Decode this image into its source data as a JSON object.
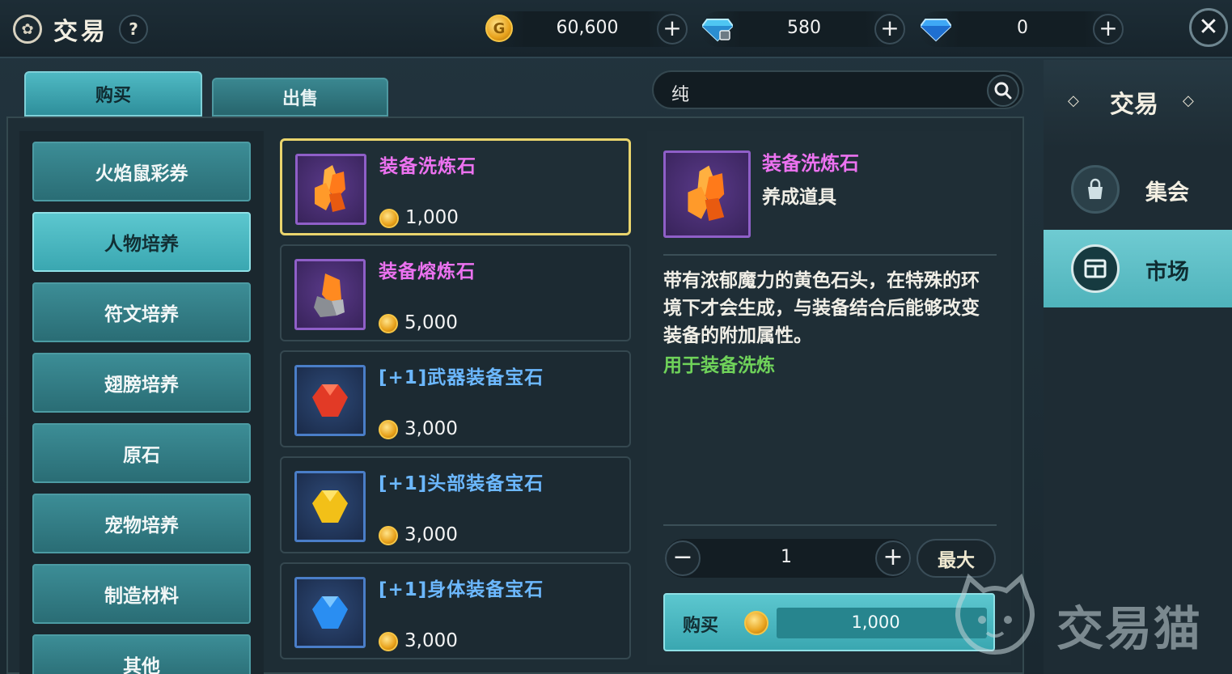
{
  "header": {
    "title": "交易",
    "help": "?",
    "gold": {
      "value": "60,600",
      "coin_glyph": "G"
    },
    "bound_diamond": {
      "value": "580"
    },
    "diamond": {
      "value": "0"
    },
    "plus": "+",
    "close": "✕"
  },
  "tabs": [
    {
      "label": "购买",
      "active": true
    },
    {
      "label": "出售",
      "active": false
    }
  ],
  "search": {
    "value": "纯"
  },
  "categories": [
    {
      "label": "火焰鼠彩券",
      "active": false
    },
    {
      "label": "人物培养",
      "active": true
    },
    {
      "label": "符文培养",
      "active": false
    },
    {
      "label": "翅膀培养",
      "active": false
    },
    {
      "label": "原石",
      "active": false
    },
    {
      "label": "宠物培养",
      "active": false
    },
    {
      "label": "制造材料",
      "active": false
    },
    {
      "label": "其他",
      "active": false
    }
  ],
  "items": [
    {
      "name": "装备洗炼石",
      "price": "1,000",
      "rarity": "purple",
      "icon": "orange-crystal-icon",
      "selected": true
    },
    {
      "name": "装备熔炼石",
      "price": "5,000",
      "rarity": "purple",
      "icon": "molten-stone-icon",
      "selected": false
    },
    {
      "name": "[+1]武器装备宝石",
      "price": "3,000",
      "rarity": "blue",
      "icon": "red-gem-icon",
      "selected": false
    },
    {
      "name": "[+1]头部装备宝石",
      "price": "3,000",
      "rarity": "blue",
      "icon": "yellow-gem-icon",
      "selected": false
    },
    {
      "name": "[+1]身体装备宝石",
      "price": "3,000",
      "rarity": "blue",
      "icon": "blue-gem-icon",
      "selected": false
    }
  ],
  "detail": {
    "name": "装备洗炼石",
    "type": "养成道具",
    "description": "带有浓郁魔力的黄色石头，在特殊的环境下才会生成，与装备结合后能够改变装备的附加属性。",
    "usage": "用于装备洗炼",
    "quantity": "1",
    "minus": "−",
    "plus": "+",
    "max_label": "最大",
    "buy_label": "购买",
    "buy_price": "1,000"
  },
  "sidebar": {
    "title": "交易",
    "items": [
      {
        "label": "集会",
        "icon": "bag-icon",
        "active": false
      },
      {
        "label": "市场",
        "icon": "market-icon",
        "active": true
      }
    ]
  },
  "watermark": "交易猫",
  "colors": {
    "accent": "#4fb9c3",
    "purple_name": "#ec72f0",
    "blue_name": "#6cb8ff",
    "usage_green": "#6fd25a",
    "selected_border": "#e9d46d"
  }
}
